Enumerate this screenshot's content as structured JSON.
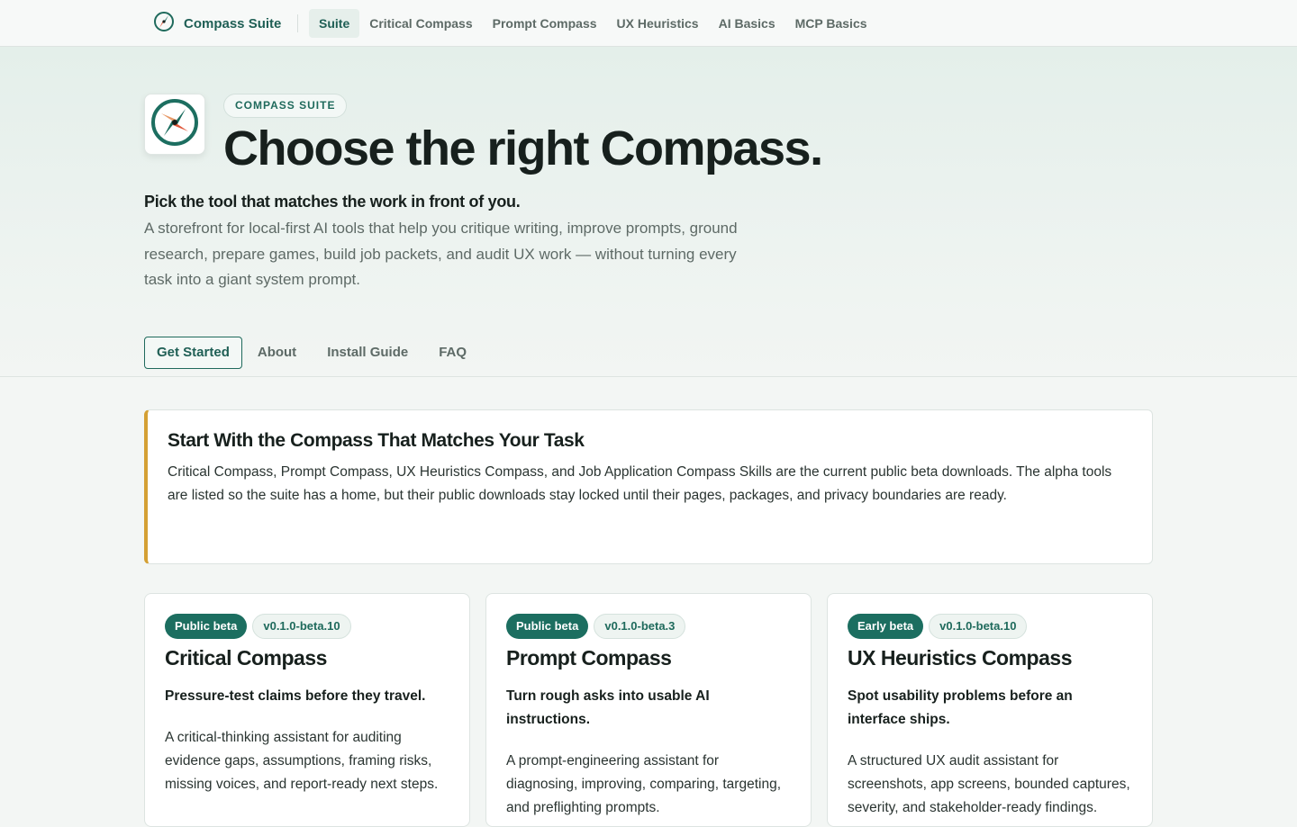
{
  "topbar": {
    "brand": "Compass Suite",
    "nav": [
      "Suite",
      "Critical Compass",
      "Prompt Compass",
      "UX Heuristics",
      "AI Basics",
      "MCP Basics"
    ]
  },
  "hero": {
    "eyebrow": "COMPASS SUITE",
    "title": "Choose the right Compass.",
    "lead": "Pick the tool that matches the work in front of you.",
    "description": "A storefront for local-first AI tools that help you critique writing, improve prompts, ground research, prepare games, build job packets, and audit UX work — without turning every task into a giant system prompt.",
    "subnav": [
      "Get Started",
      "About",
      "Install Guide",
      "FAQ"
    ]
  },
  "callout": {
    "title": "Start With the Compass That Matches Your Task",
    "text": "Critical Compass, Prompt Compass, UX Heuristics Compass, and Job Application Compass Skills are the current public beta downloads. The alpha tools are listed so the suite has a home, but their public downloads stay locked until their pages, packages, and privacy boundaries are ready."
  },
  "cards": [
    {
      "status": "Public beta",
      "version": "v0.1.0-beta.10",
      "title": "Critical Compass",
      "tagline": "Pressure-test claims before they travel.",
      "body": "A critical-thinking assistant for auditing evidence gaps, assumptions, framing risks, missing voices, and report-ready next steps."
    },
    {
      "status": "Public beta",
      "version": "v0.1.0-beta.3",
      "title": "Prompt Compass",
      "tagline": "Turn rough asks into usable AI instructions.",
      "body": "A prompt-engineering assistant for diagnosing, improving, comparing, targeting, and preflighting prompts."
    },
    {
      "status": "Early beta",
      "version": "v0.1.0-beta.10",
      "title": "UX Heuristics Compass",
      "tagline": "Spot usability problems before an interface ships.",
      "body": "A structured UX audit assistant for screenshots, app screens, bounded captures, severity, and stakeholder-ready findings."
    }
  ],
  "colors": {
    "accent": "#1f6a5c",
    "callout_bar": "#d4a034",
    "compass_red": "#e0573a"
  },
  "icons": {
    "brand": "compass-icon",
    "hero": "compass-icon"
  }
}
